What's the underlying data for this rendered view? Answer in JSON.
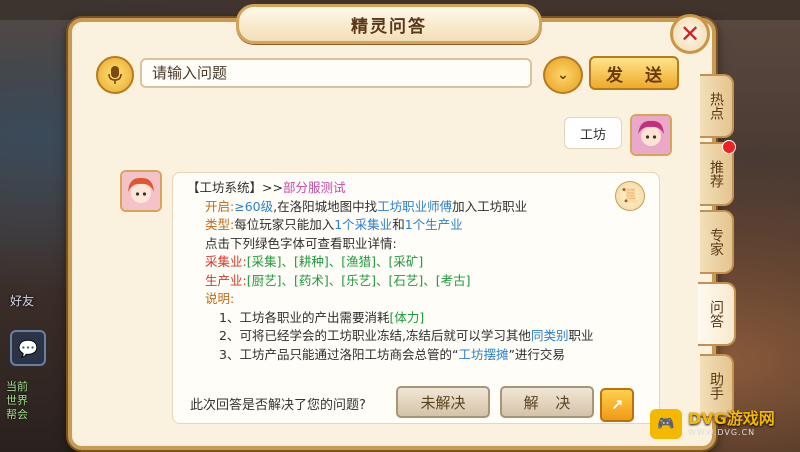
{
  "dialog": {
    "title": "精灵问答"
  },
  "input": {
    "placeholder": "请输入问题",
    "send_label": "发 送"
  },
  "tabs": [
    {
      "label": "热点"
    },
    {
      "label": "推荐"
    },
    {
      "label": "专家"
    },
    {
      "label": "问答"
    },
    {
      "label": "助手"
    }
  ],
  "user_message": "工坊",
  "answer": {
    "header_prefix": "【工坊系统】>>",
    "header_link": "部分服测试",
    "open_label": "开启:",
    "open_level": "≥60级",
    "open_text_1": ",在洛阳城地图中找",
    "open_npc": "工坊职业师傅",
    "open_text_2": "加入工坊职业",
    "type_label": "类型:",
    "type_text_1": "每位玩家只能加入",
    "type_gather": "1个采集业",
    "type_text_2": "和",
    "type_produce": "1个生产业",
    "click_hint": "点击下列绿色字体可查看职业详情:",
    "gather_label": "采集业:",
    "gather_items": "[采集]、[耕种]、[渔猎]、[采矿]",
    "produce_label": "生产业:",
    "produce_items": "[厨艺]、[药术]、[乐艺]、[石艺]、[考古]",
    "explain_label": "说明:",
    "note1_text": "1、工坊各职业的产出需要消耗",
    "note1_energy": "[体力]",
    "note2_text_1": "2、可将已经学会的工坊职业冻结,冻结后就可以学习其他",
    "note2_link": "同类别",
    "note2_text_2": "职业",
    "note3_text_1": "3、工坊产品只能通过洛阳工坊商会总管的“",
    "note3_link": "工坊摆摊",
    "note3_text_2": "”进行交易"
  },
  "feedback": {
    "question": "此次回答是否解决了您的问题?",
    "unsolved_label": "未解决",
    "solved_label": "解 决"
  },
  "hud": {
    "friends_label": "好友",
    "chat_lines": [
      "当前",
      "世界",
      "帮会"
    ]
  },
  "watermark": {
    "main": "DVG游戏网",
    "sub": "WWW.DVG.CN"
  },
  "icons": {
    "mic": "microphone-icon",
    "dropdown": "chevron-down-icon",
    "close": "close-icon",
    "note": "scroll-icon",
    "share": "share-icon"
  },
  "colors": {
    "panel": "#fbf1df",
    "border": "#c89a52",
    "close": "#d61f1f",
    "link_blue": "#2c7fd0",
    "link_pink": "#c54aa8",
    "green": "#1f9a3a",
    "orange": "#c46a1a"
  }
}
